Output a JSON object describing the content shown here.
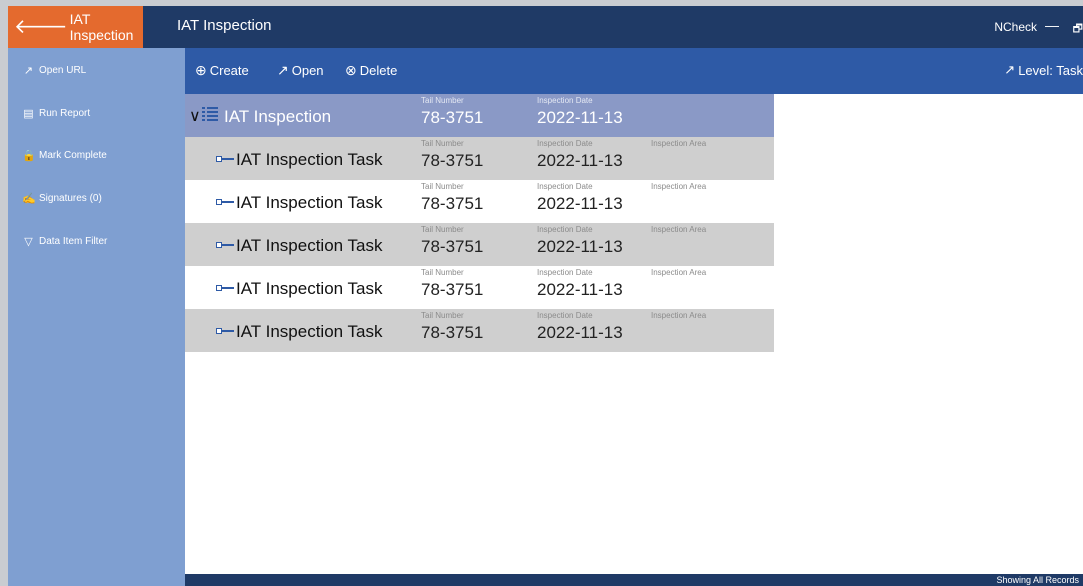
{
  "titlebar": {
    "back_label": "IAT Inspection",
    "page_title": "IAT Inspection",
    "app_name": "NCheck",
    "minimize": "—",
    "restore": "🗗"
  },
  "sidebar": {
    "items": [
      {
        "label": "Open URL",
        "icon": "external-link-icon"
      },
      {
        "label": "Run Report",
        "icon": "report-icon"
      },
      {
        "label": "Mark Complete",
        "icon": "lock-icon"
      },
      {
        "label": "Signatures (0)",
        "icon": "signature-icon"
      },
      {
        "label": "Data Item Filter",
        "icon": "filter-icon"
      }
    ]
  },
  "toolbar": {
    "create_label": "Create",
    "open_label": "Open",
    "delete_label": "Delete",
    "level_label": "Level: Task"
  },
  "field_labels": {
    "tail_number": "Tail Number",
    "inspection_date": "Inspection Date",
    "inspection_area": "Inspection Area"
  },
  "parent": {
    "title": "IAT Inspection",
    "tail_number": "78-3751",
    "inspection_date": "2022-11-13"
  },
  "tasks": [
    {
      "title": "IAT Inspection Task",
      "tail_number": "78-3751",
      "inspection_date": "2022-11-13"
    },
    {
      "title": "IAT Inspection Task",
      "tail_number": "78-3751",
      "inspection_date": "2022-11-13"
    },
    {
      "title": "IAT Inspection Task",
      "tail_number": "78-3751",
      "inspection_date": "2022-11-13"
    },
    {
      "title": "IAT Inspection Task",
      "tail_number": "78-3751",
      "inspection_date": "2022-11-13"
    },
    {
      "title": "IAT Inspection Task",
      "tail_number": "78-3751",
      "inspection_date": "2022-11-13"
    }
  ],
  "statusbar": {
    "text": "Showing All Records"
  },
  "colors": {
    "titlebar": "#1f3a66",
    "back_button": "#e46a2e",
    "sidebar": "#7f9fd1",
    "toolbar": "#2e5aa6",
    "parent_row": "#8a99c6",
    "alt_row": "#cfcfcf"
  }
}
